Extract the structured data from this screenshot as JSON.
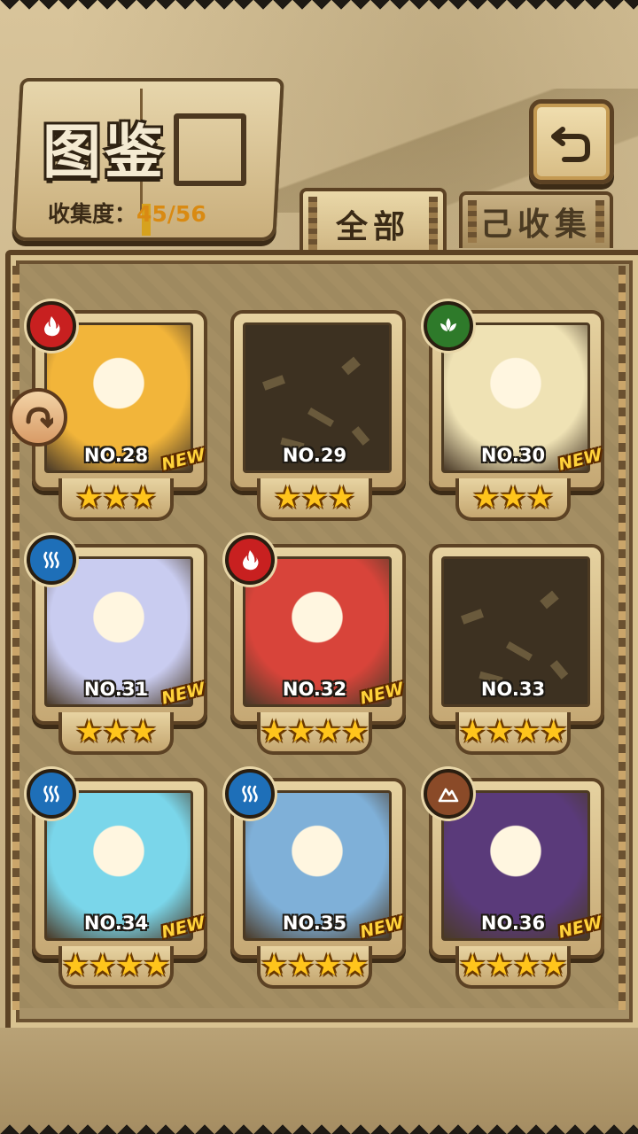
{
  "header": {
    "title": "图鉴",
    "collection_label": "收集度：",
    "collection_value": "45/56"
  },
  "tabs": [
    {
      "label": "全部",
      "active": true
    },
    {
      "label": "己收集",
      "active": false
    }
  ],
  "colors": {
    "fire": "#c82020",
    "nature": "#2e7a2a",
    "water": "#1e6fb8",
    "earth": "#8a4a28",
    "star": "#ffc51c"
  },
  "cards": [
    {
      "no": "NO.28",
      "element": "fire",
      "stars": 3,
      "new": "NEW",
      "locked": false,
      "art": "#f2b53a"
    },
    {
      "no": "NO.29",
      "element": "",
      "stars": 3,
      "new": "",
      "locked": true,
      "art": ""
    },
    {
      "no": "NO.30",
      "element": "nature",
      "stars": 3,
      "new": "NEW",
      "locked": false,
      "art": "#efe2b4"
    },
    {
      "no": "NO.31",
      "element": "water",
      "stars": 3,
      "new": "NEW",
      "locked": false,
      "art": "#c9ccf0"
    },
    {
      "no": "NO.32",
      "element": "fire",
      "stars": 4,
      "new": "NEW",
      "locked": false,
      "art": "#d8443a"
    },
    {
      "no": "NO.33",
      "element": "",
      "stars": 4,
      "new": "",
      "locked": true,
      "art": ""
    },
    {
      "no": "NO.34",
      "element": "water",
      "stars": 4,
      "new": "NEW",
      "locked": false,
      "art": "#7ad6ea"
    },
    {
      "no": "NO.35",
      "element": "water",
      "stars": 4,
      "new": "NEW",
      "locked": false,
      "art": "#7fb0d8"
    },
    {
      "no": "NO.36",
      "element": "earth",
      "stars": 4,
      "new": "NEW",
      "locked": false,
      "art": "#5a3a7a"
    }
  ]
}
